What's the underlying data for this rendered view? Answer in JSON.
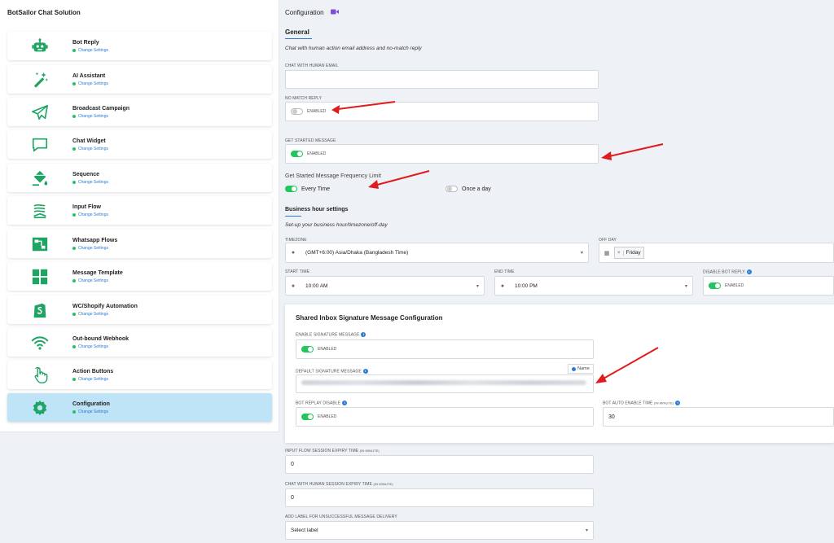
{
  "sidebar": {
    "title": "BotSailor Chat Solution",
    "items": [
      {
        "label": "Bot Reply",
        "link": "Change Settings",
        "icon": "robot-icon"
      },
      {
        "label": "AI Assistant",
        "link": "Change Settings",
        "icon": "magic-wand-icon"
      },
      {
        "label": "Broadcast Campaign",
        "link": "Change Settings",
        "icon": "paper-plane-icon"
      },
      {
        "label": "Chat Widget",
        "link": "Change Settings",
        "icon": "chat-bubble-icon"
      },
      {
        "label": "Sequence",
        "link": "Change Settings",
        "icon": "paint-bucket-icon"
      },
      {
        "label": "Input Flow",
        "link": "Change Settings",
        "icon": "stack-icon"
      },
      {
        "label": "Whatsapp Flows",
        "link": "Change Settings",
        "icon": "flow-icon"
      },
      {
        "label": "Message Template",
        "link": "Change Settings",
        "icon": "grid-icon"
      },
      {
        "label": "WC/Shopify Automation",
        "link": "Change Settings",
        "icon": "shopify-icon"
      },
      {
        "label": "Out-bound Webhook",
        "link": "Change Settings",
        "icon": "wifi-icon"
      },
      {
        "label": "Action Buttons",
        "link": "Change Settings",
        "icon": "hand-pointer-icon"
      },
      {
        "label": "Configuration",
        "link": "Change Settings",
        "icon": "gear-icon"
      }
    ],
    "active_index": 11
  },
  "header": {
    "title": "Configuration",
    "video_icon": "video-icon"
  },
  "general": {
    "tab": "General",
    "note": "Chat with human action email address and no-match reply",
    "chat_email_label": "CHAT WITH HUMAN EMAIL",
    "chat_email_value": "",
    "no_match_label": "NO MATCH REPLY",
    "no_match_state": "ENABLED",
    "get_started_label": "GET STARTED MESSAGE",
    "get_started_state": "ENABLED",
    "freq_label": "Get Started Message Frequency Limit",
    "freq_options": [
      "Every Time",
      "Once a day"
    ]
  },
  "business": {
    "heading": "Business hour settings",
    "note": "Set-up your business hour/timezone/off-day",
    "timezone_label": "TIMEZONE",
    "timezone_value": "(GMT+6:00) Asia/Dhaka (Bangladesh Time)",
    "offday_label": "OFF DAY",
    "offday_chip": "×",
    "offday_value": "Friday",
    "start_label": "START TIME",
    "start_value": "10:00 AM",
    "end_label": "END TIME",
    "end_value": "10:00 PM",
    "disable_bot_label": "DISABLE BOT REPLY",
    "disable_bot_state": "ENABLED"
  },
  "signature": {
    "heading": "Shared Inbox Signature Message Configuration",
    "enable_label": "ENABLE SIGNATURE MESSAGE",
    "enable_state": "ENABLED",
    "default_label": "DEFAULT SIGNATURE MESSAGE",
    "name_button": "Name",
    "bot_replay_label": "BOT REPLAY DISABLE",
    "bot_replay_state": "ENABLED",
    "auto_enable_label": "BOT AUTO ENABLE TIME",
    "auto_enable_unit": "(IN MINUTE)",
    "auto_enable_value": "30"
  },
  "session": {
    "input_flow_label": "INPUT FLOW SESSION EXPIRY TIME",
    "input_flow_unit": "(IN MINUTE)",
    "input_flow_value": "0",
    "chat_human_label": "CHAT WITH HUMAN SESSION EXPIRY TIME",
    "chat_human_unit": "(IN MINUTE)",
    "chat_human_value": "0",
    "add_label_label": "ADD LABEL FOR UNSUCCESSFUL MESSAGE DELIVERY",
    "add_label_value": "Select label"
  },
  "colors": {
    "accent": "#2b7bd6",
    "toggle_on": "#22c55e",
    "icon_green": "#1fa463",
    "active_bg": "#bfe3f7",
    "arrow": "#e01b1b"
  }
}
